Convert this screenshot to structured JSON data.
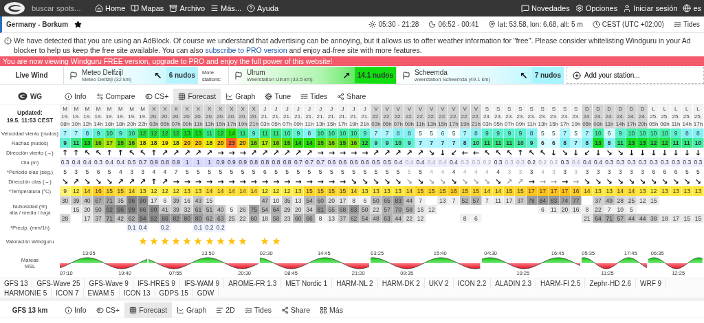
{
  "nav": {
    "search": {
      "placeholder": "buscar spots..."
    },
    "links": [
      {
        "label": "Home"
      },
      {
        "label": "Mapas"
      },
      {
        "label": "Archivo"
      },
      {
        "label": "Más..."
      },
      {
        "label": "Ayuda"
      }
    ],
    "right_links": [
      {
        "label": "Novedades"
      },
      {
        "label": "Opciones"
      },
      {
        "label": "Iniciar sesión"
      },
      {
        "label": "es"
      }
    ]
  },
  "spot": {
    "title": "Germany - Borkum",
    "favorite": true,
    "info": [
      "05:30 - 21:28",
      "06:52 - 00:41",
      "lat: 53.58, lon: 6.68, alt: 5 m",
      "CEST (UTC +02:00)",
      "Tides"
    ]
  },
  "notice": {
    "before": "We have detected that you are using an AdBlock. Of course we understand that advertising can be annoying, but it allows us to offer weather information for \"free\". Please consider whitelisting Windguru in your Ad blocker to help us keep the free site available. You can also ",
    "link": "subscribe to PRO version",
    "after": " and enjoy ad-free site with more features."
  },
  "banner": "You are now viewing Windguru FREE version, upgrade to PRO and enjoy the full power of this website!",
  "live_wind": {
    "label": "Live Wind",
    "more_label": "More stations:",
    "add": "Add your station...",
    "stations": [
      {
        "name": "Meteo Delfzijl",
        "sub": "Meteo Delfzijl  (32 km)",
        "reading": "6 nudos",
        "dir": "↖",
        "color": "#b4f4ff"
      },
      {
        "name": "Ulrum",
        "sub": "Weerstation Ulrum  (33.5 km)",
        "reading": "14.1 nudos",
        "dir": "↗",
        "color": "#11dd11"
      },
      {
        "name": "Scheemda",
        "sub": "weerstation Scheemda  (49.1 km)",
        "reading": "7 nudos",
        "dir": "↖",
        "color": "#a8f4ff"
      }
    ]
  },
  "model_bar": {
    "title": "WG",
    "tabs": [
      {
        "label": "Info",
        "selected": false
      },
      {
        "label": "Compare",
        "selected": false
      },
      {
        "label": "CS+",
        "selected": false
      },
      {
        "label": "Forecast",
        "selected": true
      },
      {
        "label": "Graph",
        "selected": false
      },
      {
        "label": "Tune",
        "selected": false
      },
      {
        "label": "Tides",
        "selected": false
      },
      {
        "label": "Share",
        "selected": false
      }
    ]
  },
  "table": {
    "updated": [
      "Updated:",
      "19.5. 11:53 CEST"
    ],
    "row_labels": {
      "wind": "Velocidad viento (nudos)",
      "gust": "Rachas (nudos)",
      "wind_dir": "Dirección viento (→)",
      "wave": "Ola (m)",
      "period": "*Período olas (seg.)",
      "wave_dir": "Dirección olas (→)",
      "temp": "*Temperatura (°C)",
      "cloud": "Nubosidad (%)",
      "cloud_sub": "alta / media / baja",
      "precip": "*Precip. (mm/1h)",
      "rating": "Valoración Windguru",
      "tides": "Mareas",
      "tides_sub": "MSL"
    },
    "columns": [
      {
        "day": "M",
        "date": "19.",
        "hour": "08h",
        "wind": "7",
        "gust": "9",
        "wind_dir": "↑",
        "wave": "0.3",
        "period": "5",
        "wave_dir": "↘",
        "temp": "9",
        "cloud_high": "30",
        "cloud_low": "28",
        "star": false,
        "faded": false
      },
      {
        "day": "M",
        "date": "19.",
        "hour": "10h",
        "wind": "7",
        "gust": "11",
        "wind_dir": "↑",
        "wave": "0.4",
        "period": "3",
        "wave_dir": "↗",
        "temp": "12",
        "cloud_high": "39",
        "cloud_mid": "15",
        "star": false,
        "faded": false
      },
      {
        "day": "M",
        "date": "19.",
        "hour": "12h",
        "wind": "8",
        "gust": "13",
        "wind_dir": "↖",
        "wave": "0.4",
        "period": "5",
        "wave_dir": "↘",
        "temp": "14",
        "cloud_high": "40",
        "cloud_mid": "20",
        "cloud_low": "17",
        "star": false,
        "faded": false
      },
      {
        "day": "M",
        "date": "19.",
        "hour": "14h",
        "wind": "9",
        "gust": "16",
        "wind_dir": "↖",
        "wave": "0.3",
        "period": "6",
        "wave_dir": "↘",
        "temp": "16",
        "cloud_high": "67",
        "cloud_mid": "50",
        "cloud_low": "37",
        "star": false,
        "faded": false
      },
      {
        "day": "M",
        "date": "19.",
        "hour": "16h",
        "wind": "10",
        "gust": "17",
        "wind_dir": "↑",
        "wave": "0.4",
        "period": "5",
        "wave_dir": "↘",
        "temp": "15",
        "cloud_high": "71",
        "cloud_mid": "92",
        "cloud_low": "71",
        "star": false,
        "faded": false
      },
      {
        "day": "M",
        "date": "19.",
        "hour": "18h",
        "wind": "9",
        "gust": "15",
        "wind_dir": "↑",
        "wave": "0.4",
        "period": "4",
        "wave_dir": "↗",
        "temp": "15",
        "cloud_high": "35",
        "cloud_mid": "96",
        "cloud_low": "42",
        "star": false,
        "faded": false
      },
      {
        "day": "M",
        "date": "19.",
        "hour": "20h",
        "wind": "10",
        "gust": "16",
        "wind_dir": "↖",
        "wave": "0.5",
        "period": "3",
        "wave_dir": "↗",
        "temp": "14",
        "cloud_high": "96",
        "cloud_mid": "99",
        "cloud_low": "62",
        "precip": "0.1",
        "star": false,
        "faded": false
      },
      {
        "day": "M",
        "date": "19.",
        "hour": "22h",
        "wind": "12",
        "gust": "18",
        "wind_dir": "↖",
        "wave": "0.7",
        "period": "3",
        "wave_dir": "↗",
        "temp": "13",
        "cloud_high": "90",
        "cloud_mid": "86",
        "cloud_low": "94",
        "precip": "0.4",
        "star": true,
        "faded": false
      },
      {
        "day": "X",
        "date": "20.",
        "hour": "03h",
        "wind": "12",
        "gust": "18",
        "wind_dir": "↑",
        "wave": "0.9",
        "period": "4",
        "wave_dir": "↑",
        "temp": "12",
        "cloud_high": "17",
        "cloud_mid": "90",
        "cloud_low": "92",
        "star": true,
        "faded": false
      },
      {
        "day": "X",
        "date": "20.",
        "hour": "05h",
        "wind": "12",
        "gust": "19",
        "wind_dir": "↗",
        "wave": "0.8",
        "period": "4",
        "wave_dir": "↗",
        "temp": "12",
        "cloud_high": "6",
        "cloud_mid": "41",
        "cloud_low": "86",
        "precip": "0.2",
        "star": true,
        "faded": false
      },
      {
        "day": "X",
        "date": "20.",
        "hour": "07h",
        "wind": "12",
        "gust": "18",
        "wind_dir": "↗",
        "wave": "0.9",
        "period": "7",
        "wave_dir": "→",
        "temp": "12",
        "cloud_high": "39",
        "cloud_mid": "39",
        "cloud_low": "82",
        "star": true,
        "faded": false
      },
      {
        "day": "X",
        "date": "20.",
        "hour": "09h",
        "wind": "13",
        "gust": "20",
        "wind_dir": "↗",
        "wave": "1",
        "period": "5",
        "wave_dir": "→",
        "temp": "13",
        "cloud_high": "16",
        "cloud_mid": "32",
        "cloud_low": "80",
        "star": true,
        "faded": false
      },
      {
        "day": "X",
        "date": "20.",
        "hour": "11h",
        "wind": "13",
        "gust": "20",
        "wind_dir": "↗",
        "wave": "1",
        "period": "5",
        "wave_dir": "→",
        "temp": "13",
        "cloud_high": "43",
        "cloud_mid": "61",
        "cloud_low": "80",
        "precip": "0.1",
        "star": true,
        "faded": false
      },
      {
        "day": "X",
        "date": "20.",
        "hour": "13h",
        "wind": "11",
        "gust": "18",
        "wind_dir": "↗",
        "wave": "1",
        "period": "5",
        "wave_dir": "→",
        "temp": "14",
        "cloud_high": "15",
        "cloud_mid": "51",
        "cloud_low": "62",
        "precip": "0.2",
        "star": true,
        "faded": false
      },
      {
        "day": "X",
        "date": "20.",
        "hour": "15h",
        "wind": "12",
        "gust": "20",
        "wind_dir": "→",
        "wave": "0.9",
        "period": "5",
        "wave_dir": "→",
        "temp": "14",
        "cloud_mid": "40",
        "cloud_low": "63",
        "precip": "0.2",
        "star": true,
        "faded": false
      },
      {
        "day": "X",
        "date": "20.",
        "hour": "17h",
        "wind": "14",
        "gust": "23",
        "wind_dir": "→",
        "wave": "0.9",
        "period": "5",
        "wave_dir": "→",
        "temp": "14",
        "cloud_mid": "5",
        "cloud_low": "25",
        "star": true,
        "faded": false
      },
      {
        "day": "X",
        "date": "20.",
        "hour": "19h",
        "wind": "11",
        "gust": "20",
        "wind_dir": "→",
        "wave": "0.9",
        "period": "5",
        "wave_dir": "→",
        "temp": "14",
        "cloud_mid": "26",
        "cloud_low": "22",
        "star": true,
        "faded": false
      },
      {
        "day": "X",
        "date": "20.",
        "hour": "21h",
        "wind": "9",
        "gust": "16",
        "wind_dir": "↗",
        "wave": "0.8",
        "period": "5",
        "wave_dir": "→",
        "temp": "14",
        "cloud_mid": "75",
        "cloud_low": "60",
        "star": false,
        "faded": false
      },
      {
        "day": "J",
        "date": "21.",
        "hour": "03h",
        "wind": "11",
        "gust": "17",
        "wind_dir": "↗",
        "wave": "0.8",
        "period": "6",
        "wave_dir": "→",
        "temp": "12",
        "cloud_high": "47",
        "cloud_mid": "54",
        "cloud_low": "18",
        "star": true,
        "faded": false
      },
      {
        "day": "J",
        "date": "21.",
        "hour": "05h",
        "wind": "11",
        "gust": "16",
        "wind_dir": "↗",
        "wave": "0.8",
        "period": "5",
        "wave_dir": "→",
        "temp": "12",
        "cloud_high": "10",
        "cloud_mid": "64",
        "cloud_low": "58",
        "star": true,
        "faded": false
      },
      {
        "day": "J",
        "date": "21.",
        "hour": "07h",
        "wind": "10",
        "gust": "15",
        "wind_dir": "↗",
        "wave": "0.8",
        "period": "5",
        "wave_dir": "→",
        "temp": "12",
        "cloud_high": "35",
        "cloud_mid": "29",
        "cloud_low": "23",
        "star": false,
        "faded": false
      },
      {
        "day": "J",
        "date": "21.",
        "hour": "09h",
        "wind": "9",
        "gust": "14",
        "wind_dir": "↗",
        "wave": "0.7",
        "period": "5",
        "wave_dir": "→",
        "temp": "13",
        "cloud_high": "13",
        "cloud_mid": "20",
        "cloud_low": "60",
        "star": false,
        "faded": false
      },
      {
        "day": "J",
        "date": "21.",
        "hour": "11h",
        "wind": "8",
        "gust": "14",
        "wind_dir": "↗",
        "wave": "0.7",
        "period": "5",
        "wave_dir": "→",
        "temp": "15",
        "cloud_high": "54",
        "cloud_mid": "34",
        "cloud_low": "66",
        "star": false,
        "faded": false
      },
      {
        "day": "J",
        "date": "21.",
        "hour": "13h",
        "wind": "10",
        "gust": "15",
        "wind_dir": "→",
        "wave": "0.7",
        "period": "5",
        "wave_dir": "→",
        "temp": "15",
        "cloud_high": "60",
        "cloud_mid": "81",
        "cloud_low": "8",
        "star": false,
        "faded": false
      },
      {
        "day": "J",
        "date": "21.",
        "hour": "15h",
        "wind": "10",
        "gust": "16",
        "wind_dir": "→",
        "wave": "0.6",
        "period": "5",
        "wave_dir": "→",
        "temp": "15",
        "cloud_high": "20",
        "cloud_mid": "55",
        "cloud_low": "13",
        "star": false,
        "faded": false
      },
      {
        "day": "J",
        "date": "21.",
        "hour": "17h",
        "wind": "10",
        "gust": "15",
        "wind_dir": "→",
        "wave": "0.6",
        "period": "5",
        "wave_dir": "→",
        "temp": "15",
        "cloud_high": "17",
        "cloud_mid": "68",
        "cloud_low": "37",
        "star": false,
        "faded": false
      },
      {
        "day": "J",
        "date": "21.",
        "hour": "19h",
        "wind": "10",
        "gust": "16",
        "wind_dir": "→",
        "wave": "0.6",
        "period": "5",
        "wave_dir": "↘",
        "temp": "14",
        "cloud_high": "8",
        "cloud_mid": "83",
        "cloud_low": "62",
        "star": false,
        "faded": false
      },
      {
        "day": "J",
        "date": "21.",
        "hour": "21h",
        "wind": "9",
        "gust": "12",
        "wind_dir": "→",
        "wave": "0.6",
        "period": "5",
        "wave_dir": "↘",
        "temp": "13",
        "cloud_high": "6",
        "cloud_mid": "50",
        "cloud_low": "54",
        "star": false,
        "faded": false
      },
      {
        "day": "V",
        "date": "22.",
        "hour": "03h",
        "wind": "7",
        "gust": "9",
        "wind_dir": "↗",
        "wave": "0.5",
        "period": "5",
        "wave_dir": "↘",
        "temp": "13",
        "cloud_high": "50",
        "cloud_mid": "22",
        "cloud_low": "48",
        "star": false,
        "faded": false
      },
      {
        "day": "V",
        "date": "22.",
        "hour": "05h",
        "wind": "7",
        "gust": "9",
        "wind_dir": "↗",
        "wave": "0.5",
        "period": "5",
        "wave_dir": "↘",
        "temp": "13",
        "cloud_high": "65",
        "cloud_mid": "57",
        "cloud_low": "63",
        "star": false,
        "faded": false
      },
      {
        "day": "V",
        "date": "22.",
        "hour": "07h",
        "wind": "8",
        "gust": "10",
        "wind_dir": "↗",
        "wave": "0.4",
        "period": "5",
        "wave_dir": "↘",
        "temp": "13",
        "cloud_high": "83",
        "cloud_mid": "70",
        "cloud_low": "44",
        "star": false,
        "faded": false
      },
      {
        "day": "V",
        "date": "22.",
        "hour": "09h",
        "wind": "8",
        "gust": "9",
        "wind_dir": "↗",
        "wave": "0.4",
        "period": "5",
        "wave_dir": "↘",
        "temp": "14",
        "cloud_high": "44",
        "cloud_mid": "58",
        "cloud_low": "22",
        "star": false,
        "faded": true
      },
      {
        "day": "V",
        "date": "22.",
        "hour": "11h",
        "wind": "5",
        "gust": "7",
        "wind_dir": "↗",
        "wave": "0.4",
        "period": "5",
        "wave_dir": "↘",
        "temp": "15",
        "cloud_high": "7",
        "cloud_mid": "16",
        "cloud_low": "12",
        "star": false,
        "faded": false
      },
      {
        "day": "V",
        "date": "22.",
        "hour": "13h",
        "wind": "5",
        "gust": "7",
        "wind_dir": "↘",
        "wave": "0.4",
        "period": "4",
        "wave_dir": "↘",
        "temp": "15",
        "cloud_mid": "12",
        "star": false,
        "faded": true
      },
      {
        "day": "V",
        "date": "22.",
        "hour": "15h",
        "wind": "6",
        "gust": "7",
        "wind_dir": "↓",
        "wave": "0.4",
        "period": "4",
        "wave_dir": "↘",
        "temp": "15",
        "cloud_high": "13",
        "star": false,
        "faded": true
      },
      {
        "day": "V",
        "date": "22.",
        "hour": "17h",
        "wind": "5",
        "gust": "7",
        "wind_dir": "↙",
        "wave": "0.4",
        "period": "4",
        "wave_dir": "↘",
        "temp": "16",
        "cloud_high": "7",
        "star": false,
        "faded": false
      },
      {
        "day": "V",
        "date": "22.",
        "hour": "19h",
        "wind": "7",
        "gust": "8",
        "wind_dir": "←",
        "wave": "0.3",
        "period": "4",
        "wave_dir": "↘",
        "temp": "15",
        "cloud_high": "52",
        "cloud_low": "8",
        "star": false,
        "faded": true
      },
      {
        "day": "V",
        "date": "22.",
        "hour": "21h",
        "wind": "8",
        "gust": "10",
        "wind_dir": "←",
        "wave": "0.3",
        "period": "4",
        "wave_dir": "↘",
        "temp": "15",
        "cloud_high": "57",
        "cloud_low": "6",
        "star": false,
        "faded": true
      },
      {
        "day": "S",
        "date": "23.",
        "hour": "03h",
        "wind": "9",
        "gust": "11",
        "wind_dir": "↖",
        "wave": "0.2",
        "period": "4",
        "wave_dir": "↘",
        "temp": "14",
        "cloud_high": "7",
        "star": false,
        "faded": true
      },
      {
        "day": "S",
        "date": "23.",
        "hour": "05h",
        "wind": "9",
        "gust": "11",
        "wind_dir": "↖",
        "wave": "0.3",
        "period": "4",
        "wave_dir": "↘",
        "temp": "14",
        "cloud_high": "11",
        "star": false,
        "faded": false
      },
      {
        "day": "S",
        "date": "23.",
        "hour": "07h",
        "wind": "9",
        "gust": "11",
        "wind_dir": "↖",
        "wave": "0.3",
        "period": "3",
        "wave_dir": "↗",
        "temp": "15",
        "cloud_high": "17",
        "star": false,
        "faded": true
      },
      {
        "day": "S",
        "date": "23.",
        "hour": "09h",
        "wind": "9",
        "gust": "10",
        "wind_dir": "↑",
        "wave": "0.3",
        "period": "3",
        "wave_dir": "↗",
        "temp": "15",
        "cloud_high": "37",
        "star": false,
        "faded": true
      },
      {
        "day": "S",
        "date": "23.",
        "hour": "11h",
        "wind": "8",
        "gust": "9",
        "wind_dir": "↖",
        "wave": "0.2",
        "period": "3",
        "wave_dir": "→",
        "temp": "17",
        "cloud_high": "78",
        "star": false,
        "faded": false
      },
      {
        "day": "S",
        "date": "23.",
        "hour": "13h",
        "wind": "5",
        "gust": "6",
        "wind_dir": "↖",
        "wave": "0.2",
        "period": "4",
        "wave_dir": "→",
        "temp": "17",
        "cloud_high": "84",
        "cloud_mid": "6",
        "star": false,
        "faded": true
      },
      {
        "day": "S",
        "date": "23.",
        "hour": "15h",
        "wind": "5",
        "gust": "6",
        "wind_dir": "↓",
        "wave": "0.2",
        "period": "3",
        "wave_dir": "→",
        "temp": "17",
        "cloud_high": "83",
        "cloud_mid": "11",
        "star": false,
        "faded": true
      },
      {
        "day": "S",
        "date": "23.",
        "hour": "17h",
        "wind": "7",
        "gust": "8",
        "wind_dir": "↘",
        "wave": "0.3",
        "period": "3",
        "wave_dir": "→",
        "temp": "17",
        "cloud_high": "74",
        "cloud_mid": "20",
        "star": false,
        "faded": false
      },
      {
        "day": "S",
        "date": "23.",
        "hour": "19h",
        "wind": "5",
        "gust": "7",
        "wind_dir": "↓",
        "wave": "0.4",
        "period": "3",
        "wave_dir": "→",
        "temp": "16",
        "cloud_high": "77",
        "cloud_mid": "16",
        "star": false,
        "faded": true
      },
      {
        "day": "D",
        "date": "24.",
        "hour": "05h",
        "wind": "7",
        "gust": "8",
        "wind_dir": "↙",
        "wave": "0.4",
        "period": "3",
        "wave_dir": "↘",
        "temp": "14",
        "cloud_mid": "8",
        "cloud_low": "21",
        "star": false,
        "faded": false
      },
      {
        "day": "D",
        "date": "24.",
        "hour": "08h",
        "wind": "10",
        "gust": "13",
        "wind_dir": "↓",
        "wave": "0.4",
        "period": "3",
        "wave_dir": "↘",
        "temp": "13",
        "cloud_high": "37",
        "cloud_mid": "22",
        "cloud_low": "64",
        "star": false,
        "faded": false
      },
      {
        "day": "D",
        "date": "24.",
        "hour": "11h",
        "wind": "6",
        "gust": "8",
        "wind_dir": "↘",
        "wave": "0.3",
        "period": "3",
        "wave_dir": "↘",
        "temp": "13",
        "cloud_high": "49",
        "cloud_mid": "7",
        "cloud_low": "71",
        "star": false,
        "faded": false
      },
      {
        "day": "D",
        "date": "24.",
        "hour": "14h",
        "wind": "9",
        "gust": "11",
        "wind_dir": "↘",
        "wave": "0.3",
        "period": "3",
        "wave_dir": "↘",
        "temp": "14",
        "cloud_high": "28",
        "cloud_mid": "10",
        "cloud_low": "57",
        "star": false,
        "faded": false
      },
      {
        "day": "D",
        "date": "24.",
        "hour": "17h",
        "wind": "10",
        "gust": "13",
        "wind_dir": "↓",
        "wave": "0.3",
        "period": "3",
        "wave_dir": "↘",
        "temp": "14",
        "cloud_high": "25",
        "cloud_mid": "5",
        "cloud_low": "44",
        "star": false,
        "faded": false
      },
      {
        "day": "D",
        "date": "24.",
        "hour": "20h",
        "wind": "10",
        "gust": "13",
        "wind_dir": "↓",
        "wave": "0.3",
        "period": "3",
        "wave_dir": "↘",
        "temp": "13",
        "cloud_high": "12",
        "cloud_low": "44",
        "star": false,
        "faded": false
      },
      {
        "day": "L",
        "date": "25.",
        "hour": "05h",
        "wind": "10",
        "gust": "12",
        "wind_dir": "↓",
        "wave": "0.3",
        "period": "6",
        "wave_dir": "↘",
        "temp": "12",
        "cloud_high": "15",
        "cloud_low": "38",
        "star": false,
        "faded": false
      },
      {
        "day": "L",
        "date": "25.",
        "hour": "08h",
        "wind": "10",
        "gust": "12",
        "wind_dir": "↓",
        "wave": "0.3",
        "period": "6",
        "wave_dir": "↘",
        "temp": "13",
        "cloud_low": "18",
        "star": false,
        "faded": false
      },
      {
        "day": "L",
        "date": "25.",
        "hour": "11h",
        "wind": "9",
        "gust": "11",
        "wind_dir": "↓",
        "wave": "0.3",
        "period": "6",
        "wave_dir": "↘",
        "temp": "13",
        "cloud_low": "17",
        "star": false,
        "faded": false
      },
      {
        "day": "L",
        "date": "25.",
        "hour": "14h",
        "wind": "8",
        "gust": "11",
        "wind_dir": "↓",
        "wave": "0.3",
        "period": "5",
        "wave_dir": "↘",
        "temp": "13",
        "cloud_low": "15",
        "star": false,
        "faded": false
      },
      {
        "day": "L",
        "date": "25.",
        "hour": "17h",
        "wind": "8",
        "gust": "10",
        "wind_dir": "↓",
        "wave": "0.3",
        "period": "5",
        "wave_dir": "↘",
        "temp": "13",
        "cloud_low": "15",
        "star": false,
        "faded": false
      }
    ],
    "tides": [
      {
        "events": [
          {
            "kind": "low",
            "time": "07:10"
          },
          {
            "kind": "high",
            "time": "13:05"
          },
          {
            "kind": "low",
            "time": "19:40"
          }
        ]
      },
      {
        "events": [
          {
            "kind": "low",
            "time": "07:55"
          },
          {
            "kind": "high",
            "time": "13:50"
          },
          {
            "kind": "low",
            "time": "20:30"
          }
        ]
      },
      {
        "events": [
          {
            "kind": "high",
            "time": "02:30"
          },
          {
            "kind": "low",
            "time": "08:45"
          },
          {
            "kind": "high",
            "time": "14:45"
          },
          {
            "kind": "low",
            "time": "21:20"
          }
        ]
      },
      {
        "events": [
          {
            "kind": "high",
            "time": "03:25"
          },
          {
            "kind": "low",
            "time": "09:35"
          },
          {
            "kind": "high",
            "time": "15:40"
          }
        ]
      },
      {
        "events": [
          {
            "kind": "high",
            "time": "04:30"
          },
          {
            "kind": "low",
            "time": "10:25"
          },
          {
            "kind": "high",
            "time": "16:45"
          }
        ]
      },
      {
        "events": [
          {
            "kind": "high",
            "time": "05:35"
          },
          {
            "kind": "low",
            "time": "11:25"
          },
          {
            "kind": "high",
            "time": "17:45"
          }
        ]
      },
      {
        "events": [
          {
            "kind": "high",
            "time": "06:35"
          },
          {
            "kind": "low",
            "time": "12:25"
          }
        ]
      }
    ]
  },
  "models": [
    "GFS 13",
    "GFS-Wave 25",
    "GFS-Wave 9",
    "IFS-HRES 9",
    "IFS-WAM 9",
    "AROME-FR 1.3",
    "MET Nordic 1",
    "HARM-NL 2",
    "HARM-DK 2",
    "UKV 2",
    "ICON 2.2",
    "ALADIN 2.3",
    "HARM-FI 2.5",
    "Zephr-HD 2.6",
    "WRF 9",
    "HARMONIE 5",
    "ICON 7",
    "EWAM 5",
    "ICON 13",
    "GDPS 15",
    "GDW"
  ],
  "bottom_bar": {
    "title": "GFS 13 km",
    "tabs": [
      {
        "label": "Info",
        "selected": false
      },
      {
        "label": "CS+",
        "selected": false
      },
      {
        "label": "Forecast",
        "selected": true
      },
      {
        "label": "Graph",
        "selected": false
      },
      {
        "label": "2D",
        "selected": false
      },
      {
        "label": "Tides",
        "selected": false
      },
      {
        "label": "Share",
        "selected": false
      },
      {
        "label": "Más",
        "selected": false
      }
    ]
  }
}
